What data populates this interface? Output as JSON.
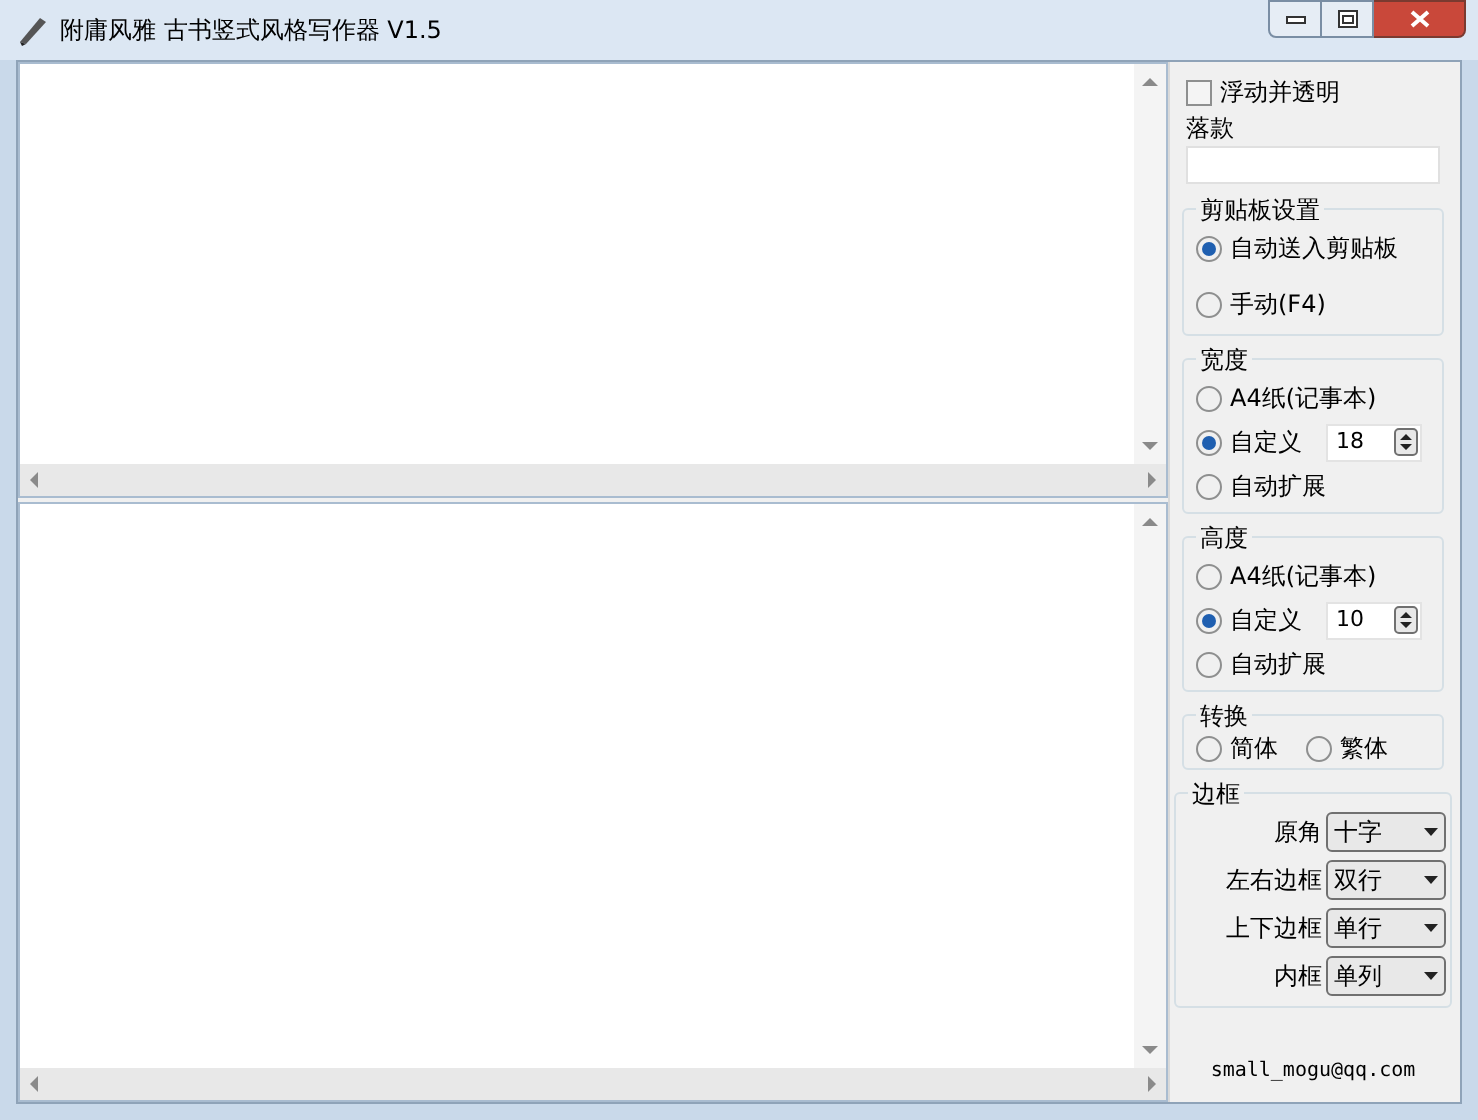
{
  "window": {
    "title": "附庸风雅 古书竖式风格写作器 V1.5"
  },
  "float_transparent": {
    "label": "浮动并透明",
    "checked": false
  },
  "signature": {
    "label": "落款"
  },
  "clipboard": {
    "title": "剪贴板设置",
    "options": [
      {
        "label": "自动送入剪贴板",
        "selected": true
      },
      {
        "label": "手动(F4)",
        "selected": false
      }
    ]
  },
  "width": {
    "title": "宽度",
    "options": [
      {
        "kind": "radio",
        "label": "A4纸(记事本)",
        "selected": false
      },
      {
        "kind": "spin",
        "label": "自定义",
        "selected": true,
        "value": "18"
      },
      {
        "kind": "radio",
        "label": "自动扩展",
        "selected": false
      }
    ]
  },
  "height": {
    "title": "高度",
    "options": [
      {
        "kind": "radio",
        "label": "A4纸(记事本)",
        "selected": false
      },
      {
        "kind": "spin",
        "label": "自定义",
        "selected": true,
        "value": "10"
      },
      {
        "kind": "radio",
        "label": "自动扩展",
        "selected": false
      }
    ]
  },
  "convert": {
    "title": "转换",
    "options": [
      {
        "label": "简体",
        "selected": false
      },
      {
        "label": "繁体",
        "selected": false
      }
    ]
  },
  "border": {
    "title": "边框",
    "rows": [
      {
        "label": "原角",
        "value": "十字"
      },
      {
        "label": "左右边框",
        "value": "双行"
      },
      {
        "label": "上下边框",
        "value": "单行"
      },
      {
        "label": "内框",
        "value": "单列"
      }
    ]
  },
  "footer": "small_mogu@qq.com"
}
